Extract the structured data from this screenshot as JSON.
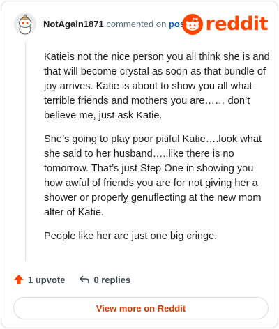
{
  "comment": {
    "username": "NotAgain1871",
    "action_text": "commented on",
    "target_text": "post",
    "brand_name": "reddit",
    "paragraphs": [
      "Katieis not the nice person you all think she is and that will become crystal as soon as that bundle of joy arrives. Katie is about to show you all what terrible friends and mothers you are…… don’t believe me, just ask Katie.",
      "She’s going to play poor pitiful Katie….look what she said to her husband…..like there is no tomorrow. That’s just Step One in showing you how awful of friends you are for not giving her a shower or properly genuflecting at the new mom alter of Katie.",
      "People like her are just one big cringe."
    ]
  },
  "actions": {
    "upvote_label": "1 upvote",
    "replies_label": "0 replies"
  },
  "footer": {
    "view_more_label": "View more on Reddit"
  },
  "colors": {
    "brand": "#ff4500",
    "link": "#0a5ac2",
    "cta": "#d93a00"
  },
  "icons": [
    "avatar-icon",
    "reddit-logo-icon",
    "upvote-arrow-icon",
    "reply-arrow-icon"
  ]
}
